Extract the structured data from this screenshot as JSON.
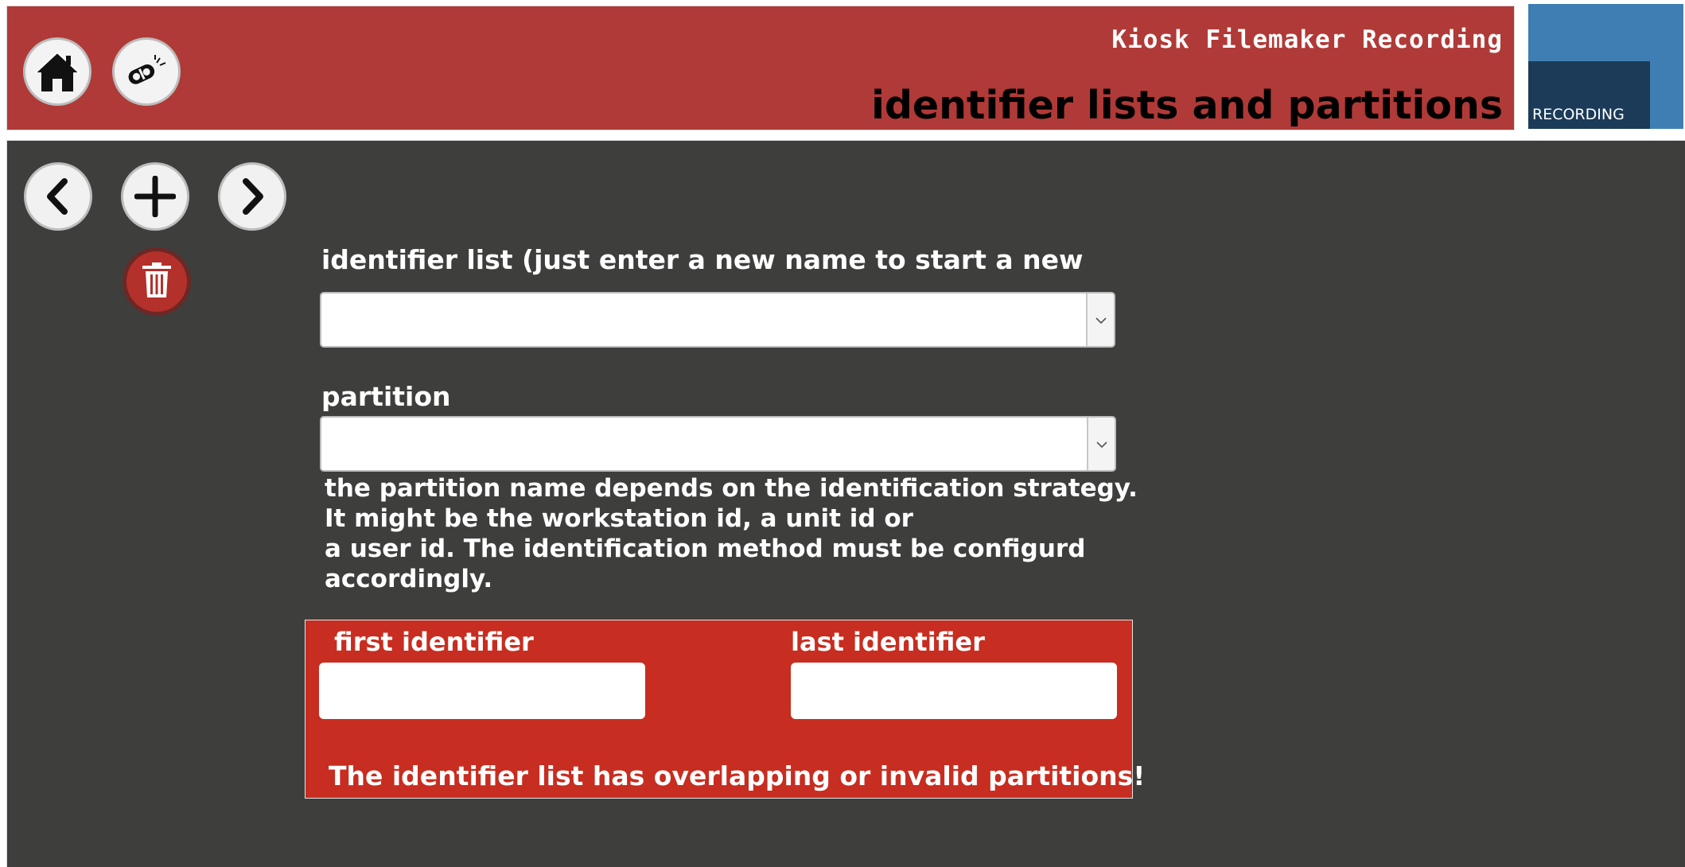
{
  "header": {
    "app_title": "Kiosk Filemaker Recording",
    "page_title": "identifier lists and partitions",
    "logo_text": "RECORDING"
  },
  "toolbar": {
    "home_icon": "home-icon",
    "settings_icon": "key-tools-icon"
  },
  "record_nav": {
    "prev_icon": "chevron-left-icon",
    "add_icon": "plus-icon",
    "next_icon": "chevron-right-icon",
    "delete_icon": "trash-icon"
  },
  "form": {
    "identifier_list_label": "identifier list (just enter a new name to start a new list)",
    "identifier_list_value": "",
    "partition_label": "partition",
    "partition_value": "",
    "help_lines": [
      "the partition name depends on the identification strategy.",
      "It might be the workstation id, a unit id or",
      "a user id. The identification method must be configurd",
      "accordingly."
    ],
    "first_identifier_label": "first identifier",
    "first_identifier_value": "",
    "last_identifier_label": "last identifier",
    "last_identifier_value": "",
    "warning": "The identifier list  has overlapping or invalid partitions!"
  },
  "colors": {
    "header_red": "#b03a37",
    "panel_dark": "#3e3e3d",
    "range_red": "#c72d20",
    "logo_blue": "#3f7eb2",
    "logo_navy": "#1b3b58"
  }
}
